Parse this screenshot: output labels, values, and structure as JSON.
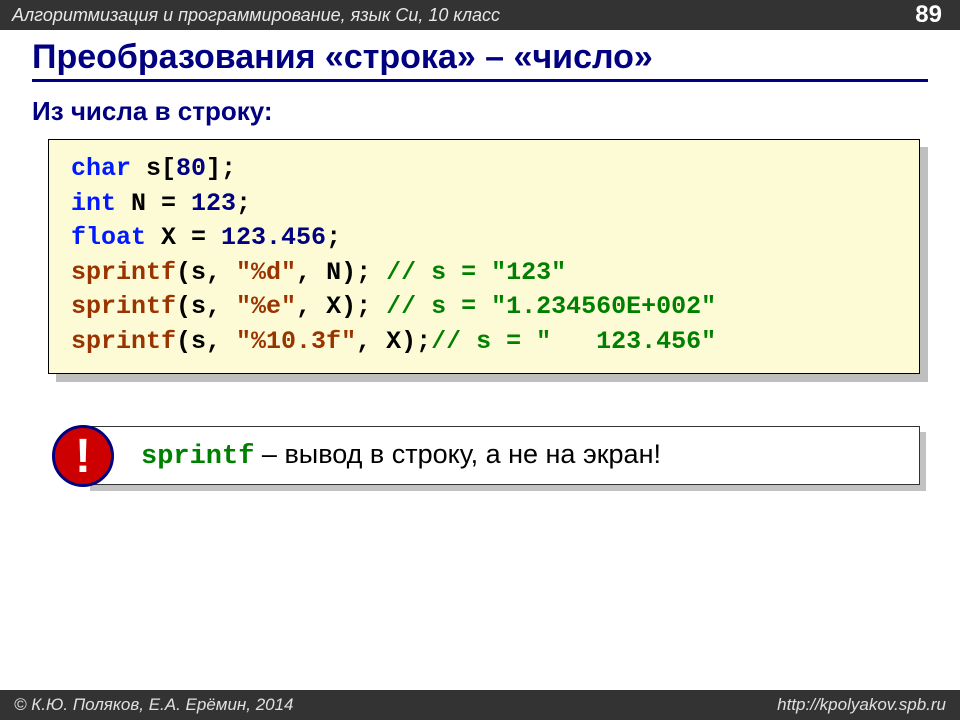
{
  "header": {
    "course": "Алгоритмизация и программирование, язык Си, 10 класс",
    "page": "89"
  },
  "title": "Преобразования «строка» – «число»",
  "subtitle": "Из числа в строку:",
  "code": {
    "l1": {
      "kw": "char",
      "rest": " s[",
      "num": "80",
      "rest2": "];"
    },
    "l2": {
      "kw": "int",
      "mid": " N = ",
      "num": "123",
      "end": ";"
    },
    "l3": {
      "kw": "float",
      "mid": " X = ",
      "num": "123.456",
      "end": ";"
    },
    "l4": {
      "fn": "sprintf",
      "args": "(s, ",
      "str": "\"%d\"",
      "args2": ", N);",
      "cmt": " // s = \"123\""
    },
    "l5": {
      "fn": "sprintf",
      "args": "(s, ",
      "str": "\"%e\"",
      "args2": ", X);",
      "cmt": " // s = \"1.234560E+002\""
    },
    "l6": {
      "fn": "sprintf",
      "args": "(s, ",
      "str": "\"%10.3f\"",
      "args2": ", X);",
      "cmt": "// s = \"   123.456\""
    }
  },
  "note": {
    "bang": "!",
    "sprintf": "sprintf",
    "rest": " – вывод в строку, а не на экран!"
  },
  "footer": {
    "left": "© К.Ю. Поляков, Е.А. Ерёмин, 2014",
    "right": "http://kpolyakov.spb.ru"
  }
}
